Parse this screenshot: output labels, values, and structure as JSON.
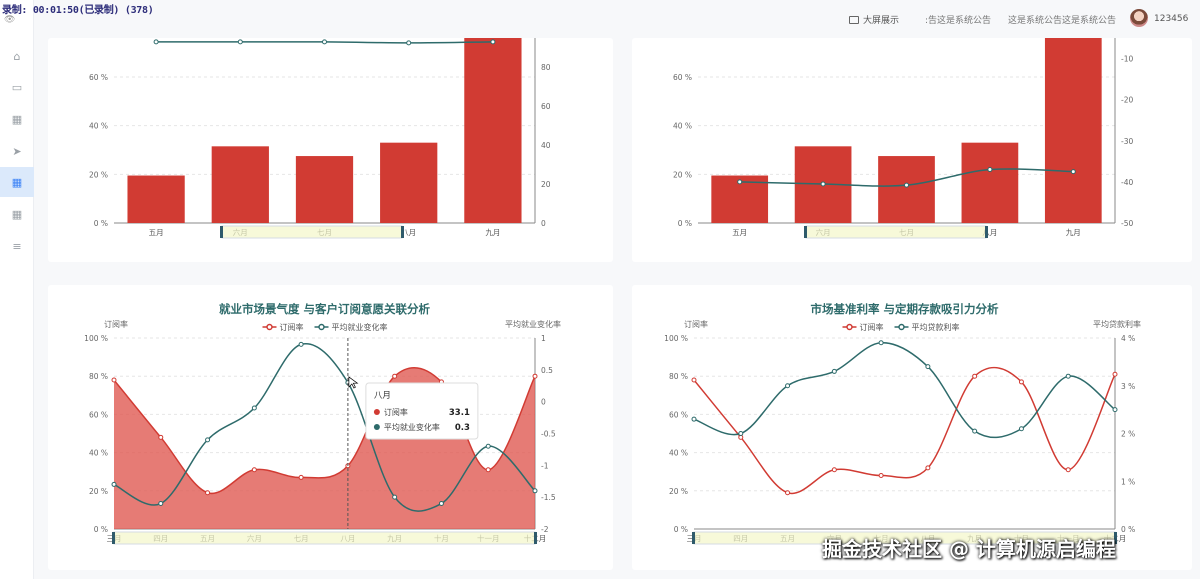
{
  "recorder": {
    "text": "录制: 00:01:50(已录制) (378)"
  },
  "topbar": {
    "fullscreen_label": "大屏展示",
    "notice_1": ":告这是系统公告",
    "notice_2": "这是系统公告这是系统公告",
    "username": "123456"
  },
  "sidebar": {
    "items": [
      {
        "icon": "home-icon",
        "glyph": "⌂"
      },
      {
        "icon": "window-icon",
        "glyph": "▭"
      },
      {
        "icon": "grid-icon",
        "glyph": "▦"
      },
      {
        "icon": "send-icon",
        "glyph": "➤"
      },
      {
        "icon": "table-icon",
        "glyph": "▦",
        "active": true
      },
      {
        "icon": "apps-icon",
        "glyph": "▦"
      },
      {
        "icon": "list-icon",
        "glyph": "≡"
      }
    ]
  },
  "colors": {
    "bar": "#d13b33",
    "line": "#2e6b6b",
    "area": "#e05a52",
    "title": "#2e6b6b"
  },
  "chart_data": [
    {
      "type": "bar",
      "categories": [
        "五月",
        "六月",
        "七月",
        "八月",
        "九月"
      ],
      "series": [
        {
          "kind": "bar",
          "axis": "left",
          "values": [
            19.5,
            31.5,
            27.5,
            33,
            76
          ]
        },
        {
          "kind": "line",
          "axis": "right",
          "values": [
            93,
            93,
            93,
            92.5,
            93
          ]
        }
      ],
      "yleft": {
        "ticks": [
          "0 %",
          "20 %",
          "40 %",
          "60 %"
        ],
        "min": 0,
        "max": 76
      },
      "yright": {
        "ticks": [
          "0",
          "20",
          "40",
          "60",
          "80"
        ],
        "min": 0,
        "max": 95
      }
    },
    {
      "type": "bar",
      "categories": [
        "五月",
        "六月",
        "七月",
        "八月",
        "九月"
      ],
      "series": [
        {
          "kind": "bar",
          "axis": "left",
          "values": [
            19.5,
            31.5,
            27.5,
            33,
            76
          ]
        },
        {
          "kind": "line",
          "axis": "right",
          "values": [
            -40,
            -40.5,
            -40.8,
            -37,
            -37.5
          ]
        }
      ],
      "yleft": {
        "ticks": [
          "0 %",
          "20 %",
          "40 %",
          "60 %"
        ],
        "min": 0,
        "max": 76
      },
      "yright": {
        "ticks": [
          "-50",
          "-40",
          "-30",
          "-20",
          "-10"
        ],
        "min": -50,
        "max": -5
      }
    },
    {
      "type": "area",
      "title": "就业市场景气度 与客户订阅意愿关联分析",
      "ylabel_left": "订阅率",
      "ylabel_right": "平均就业变化率",
      "legend": [
        "订阅率",
        "平均就业变化率"
      ],
      "categories": [
        "三月",
        "四月",
        "五月",
        "六月",
        "七月",
        "八月",
        "九月",
        "十月",
        "十一月",
        "十二月"
      ],
      "series": [
        {
          "name": "订阅率",
          "axis": "left",
          "values": [
            78,
            48,
            19,
            31,
            27,
            33.1,
            80,
            77,
            31,
            80
          ]
        },
        {
          "name": "平均就业变化率",
          "axis": "right",
          "values": [
            -1.3,
            -1.6,
            -0.6,
            -0.1,
            0.9,
            0.3,
            -1.5,
            -1.6,
            -0.7,
            -1.4
          ]
        }
      ],
      "yleft": {
        "ticks": [
          "0 %",
          "20 %",
          "40 %",
          "60 %",
          "80 %",
          "100 %"
        ],
        "min": 0,
        "max": 100
      },
      "yright": {
        "ticks": [
          "-2",
          "-1.5",
          "-1",
          "-0.5",
          "0",
          "0.5",
          "1"
        ],
        "min": -2,
        "max": 1
      },
      "tooltip": {
        "title": "八月",
        "rows": [
          {
            "label": "订阅率",
            "value": "33.1"
          },
          {
            "label": "平均就业变化率",
            "value": "0.3"
          }
        ]
      }
    },
    {
      "type": "line",
      "title": "市场基准利率 与定期存款吸引力分析",
      "ylabel_left": "订阅率",
      "ylabel_right": "平均贷款利率",
      "legend": [
        "订阅率",
        "平均贷款利率"
      ],
      "categories": [
        "三月",
        "四月",
        "五月",
        "六月",
        "七月",
        "八月",
        "九月",
        "十月",
        "十一月",
        "十二月"
      ],
      "series": [
        {
          "name": "订阅率",
          "axis": "left",
          "values": [
            78,
            48,
            19,
            31,
            28,
            32,
            80,
            77,
            31,
            81
          ]
        },
        {
          "name": "平均贷款利率",
          "axis": "right",
          "values": [
            2.3,
            2.0,
            3.0,
            3.3,
            3.9,
            3.4,
            2.05,
            2.1,
            3.2,
            2.5
          ]
        }
      ],
      "yleft": {
        "ticks": [
          "0 %",
          "20 %",
          "40 %",
          "60 %",
          "80 %",
          "100 %"
        ],
        "min": 0,
        "max": 100
      },
      "yright": {
        "ticks": [
          "0 %",
          "1 %",
          "2 %",
          "3 %",
          "4 %"
        ],
        "min": 0,
        "max": 4
      }
    }
  ],
  "watermark": "掘金技术社区 @ 计算机源启编程"
}
